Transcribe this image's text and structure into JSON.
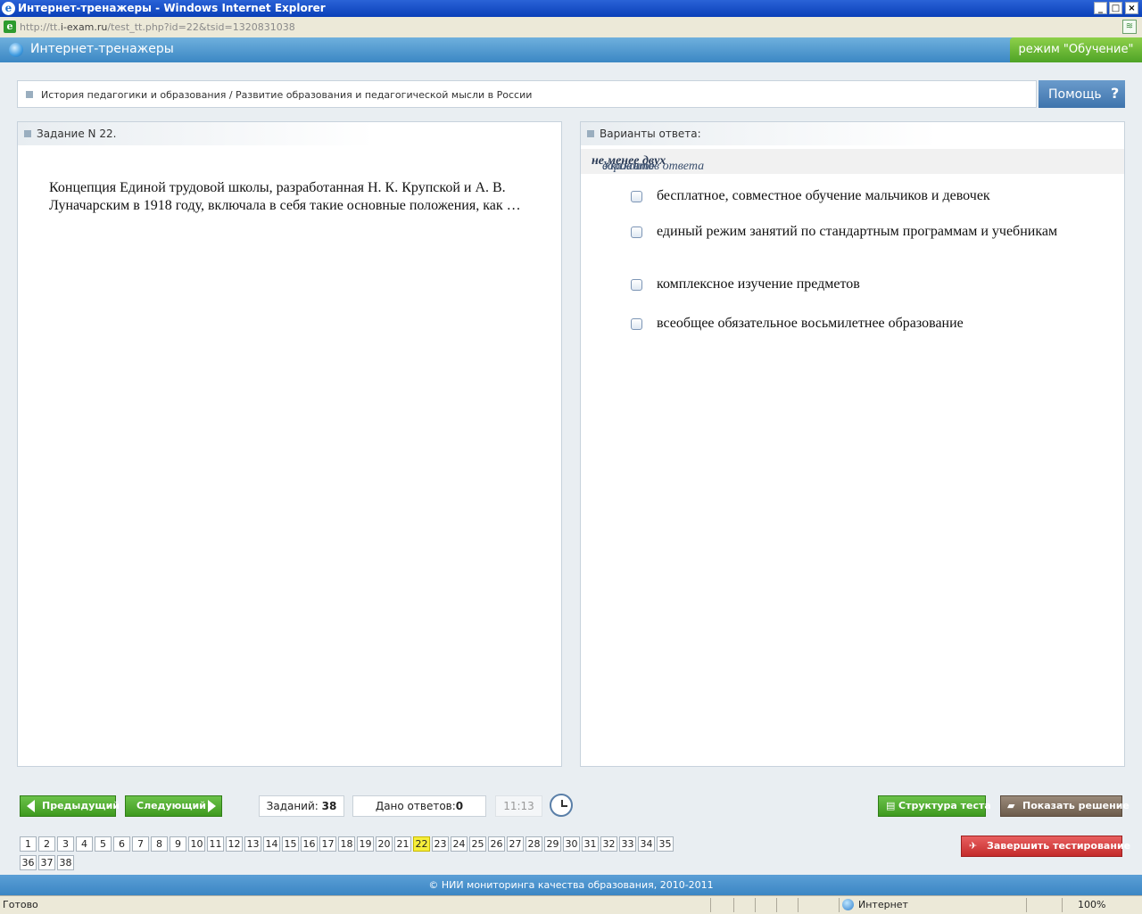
{
  "window": {
    "title": "Интернет-тренажеры - Windows Internet Explorer",
    "url_prefix": "http://tt.",
    "url_host": "i-exam.ru",
    "url_rest": "/test_tt.php?id=22&tsid=1320831038",
    "controls": {
      "minimize": "_",
      "maximize": "□",
      "close": "×"
    }
  },
  "app": {
    "title": "Интернет-тренажеры",
    "mode": "режим \"Обучение\""
  },
  "breadcrumb": "История педагогики и образования / Развитие образования и педагогической мысли в России",
  "help": {
    "label": "Помощь",
    "symbol": "?"
  },
  "task": {
    "header": "Задание N 22.",
    "text": "Концепция Единой трудовой школы, разработанная Н. К. Крупской и А. В. Луначарским в 1918 году, включала в себя такие основные положения, как …"
  },
  "answers": {
    "header": "Варианты ответа:",
    "hint_pre": "Укажите ",
    "hint_bold": "не менее двух",
    "hint_post": " вариантов ответа",
    "options": [
      {
        "text": "бесплатное, совместное обучение мальчиков и девочек",
        "checked": false
      },
      {
        "text": "единый режим занятий по стандартным программам и учебникам",
        "checked": false
      },
      {
        "text": "комплексное изучение предметов",
        "checked": false
      },
      {
        "text": "всеобщее обязательное восьмилетнее образование",
        "checked": false
      }
    ]
  },
  "toolbar": {
    "prev": "Предыдущий",
    "next": "Следующий",
    "tasks_label": "Заданий:",
    "tasks_count": "38",
    "answered_label": "Дано ответов:",
    "answered_count": "0",
    "timer": "11:13",
    "structure": "Структура теста",
    "solution": "Показать решение",
    "finish": "Завершить тестирование"
  },
  "question_numbers": [
    "1",
    "2",
    "3",
    "4",
    "5",
    "6",
    "7",
    "8",
    "9",
    "10",
    "11",
    "12",
    "13",
    "14",
    "15",
    "16",
    "17",
    "18",
    "19",
    "20",
    "21",
    "22",
    "23",
    "24",
    "25",
    "26",
    "27",
    "28",
    "29",
    "30",
    "31",
    "32",
    "33",
    "34",
    "35",
    "36",
    "37",
    "38"
  ],
  "current_question": "22",
  "footer": "© НИИ мониторинга качества образования, 2010-2011",
  "status": {
    "text": "Готово",
    "zone": "Интернет",
    "zoom": "100%"
  },
  "colors": {
    "header_blue": "#3b87c4",
    "mode_green": "#4ea326",
    "current_highlight": "#f6ee3b",
    "finish_red": "#c42b2b"
  }
}
